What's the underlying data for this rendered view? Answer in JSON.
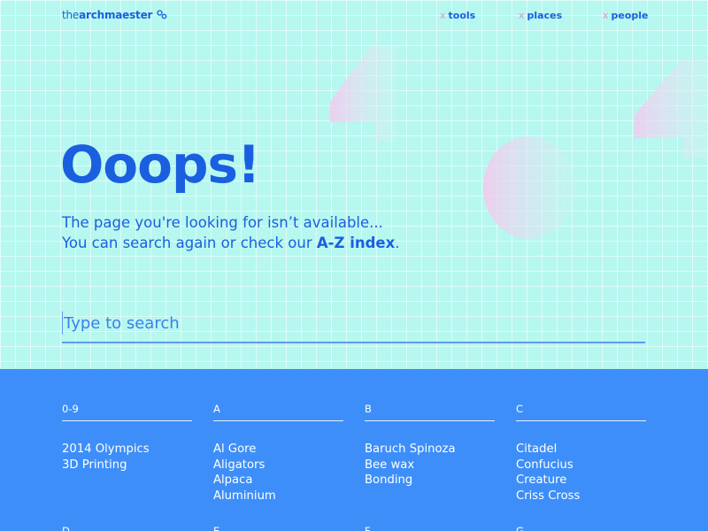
{
  "header": {
    "logo_prefix": "the",
    "logo_bold": "archmaester",
    "logo_icon": "orbit-glyph",
    "nav": [
      {
        "marker": "x",
        "label": "tools"
      },
      {
        "marker": "x",
        "label": "places"
      },
      {
        "marker": "x",
        "label": "people"
      }
    ]
  },
  "hero": {
    "title": "Ooops!",
    "line1": "The page you're looking for isn’t available...",
    "line2_prefix": "You can search again or check our ",
    "line2_link": "A-Z index",
    "line2_suffix": ".",
    "decor_icon": "faded-404-shapes"
  },
  "search": {
    "placeholder": "Type to search",
    "value": ""
  },
  "index": {
    "columns": [
      {
        "heading": "0-9",
        "items": [
          "2014 Olympics",
          "3D Printing"
        ]
      },
      {
        "heading": "A",
        "items": [
          "Al Gore",
          "Aligators",
          "Alpaca",
          "Aluminium"
        ]
      },
      {
        "heading": "B",
        "items": [
          "Baruch Spinoza",
          "Bee wax",
          "Bonding"
        ]
      },
      {
        "heading": "C",
        "items": [
          "Citadel",
          "Confucius",
          "Creature",
          "Criss Cross"
        ]
      }
    ],
    "next_row_headings": [
      "D",
      "E",
      "F",
      "G"
    ]
  },
  "colors": {
    "brand_blue": "#1a5fe0",
    "hero_bg": "#b6f7ef",
    "index_bg": "#3d8ef8",
    "accent_pink": "#e58fd0"
  }
}
